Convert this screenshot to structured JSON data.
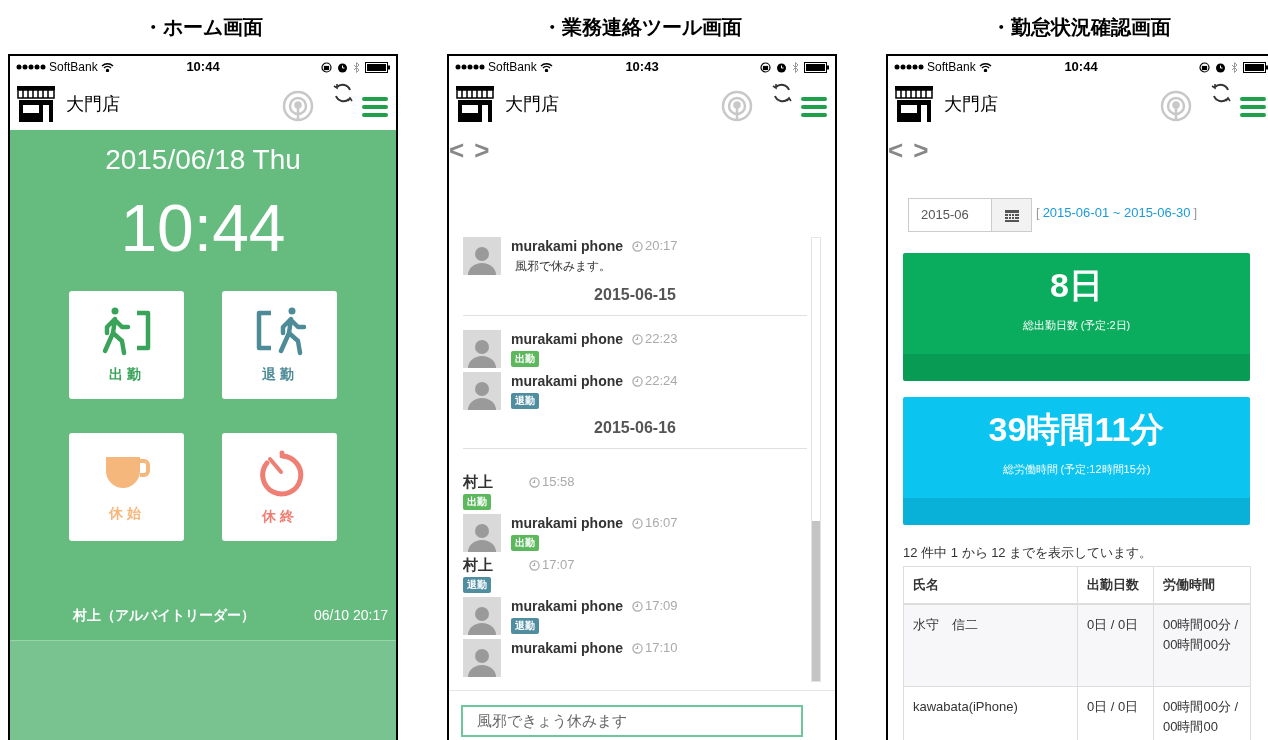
{
  "home": {
    "heading": "・ホーム画面",
    "status_bar": {
      "carrier": "SoftBank",
      "time": "10:44"
    },
    "app_bar": {
      "store": "大門店"
    },
    "date": "2015/06/18 Thu",
    "clock": "10:44",
    "buttons": [
      {
        "label": "出勤",
        "kind": "clock_in"
      },
      {
        "label": "退勤",
        "kind": "clock_out"
      },
      {
        "label": "休始",
        "kind": "break_start"
      },
      {
        "label": "休終",
        "kind": "break_end"
      }
    ],
    "last_punch": {
      "name": "村上（アルバイトリーダー）",
      "time": "06/10 20:17"
    }
  },
  "messages": {
    "heading": "・業務連絡ツール画面",
    "status_bar": {
      "carrier": "SoftBank",
      "time": "10:43"
    },
    "app_bar": {
      "store": "大門店"
    },
    "nav": {
      "prev": "<",
      "next": ">"
    },
    "feed": [
      {
        "kind": "post",
        "avatar": true,
        "name": "murakami phone",
        "time": "20:17",
        "text": "風邪で休みます。"
      },
      {
        "kind": "date",
        "text": "2015-06-15"
      },
      {
        "kind": "post",
        "avatar": true,
        "name": "murakami phone",
        "time": "22:23",
        "badge": {
          "label": "出勤",
          "color": "#5cb85c"
        }
      },
      {
        "kind": "post",
        "avatar": true,
        "name": "murakami phone",
        "time": "22:24",
        "badge": {
          "label": "退勤",
          "color": "#4f8da0"
        }
      },
      {
        "kind": "date",
        "text": "2015-06-16"
      },
      {
        "kind": "post",
        "avatar": false,
        "name": "村上",
        "time": "15:58",
        "badge": {
          "label": "出勤",
          "color": "#5cb85c"
        }
      },
      {
        "kind": "post",
        "avatar": true,
        "name": "murakami phone",
        "time": "16:07",
        "badge": {
          "label": "出勤",
          "color": "#5cb85c"
        }
      },
      {
        "kind": "post",
        "avatar": false,
        "name": "村上",
        "time": "17:07",
        "badge": {
          "label": "退勤",
          "color": "#4f8da0"
        }
      },
      {
        "kind": "post",
        "avatar": true,
        "name": "murakami phone",
        "time": "17:09",
        "badge": {
          "label": "退勤",
          "color": "#4f8da0"
        }
      },
      {
        "kind": "post",
        "avatar": true,
        "name": "murakami phone",
        "time": "17:10"
      }
    ],
    "input": {
      "value": "風邪できょう休みます"
    }
  },
  "attendance": {
    "heading": "・勤怠状況確認画面",
    "status_bar": {
      "carrier": "SoftBank",
      "time": "10:44"
    },
    "app_bar": {
      "store": "大門店"
    },
    "nav": {
      "prev": "<",
      "next": ">"
    },
    "month": "2015-06",
    "range": {
      "open": "[",
      "dates": "2015-06-01 ~ 2015-06-30",
      "close": "]"
    },
    "stats": [
      {
        "value": "8日",
        "label": "総出勤日数 (予定:2日)",
        "color": "#0aad5e"
      },
      {
        "value": "39時間11分",
        "label": "総労働時間 (予定:12時間15分)",
        "color": "#0bc4f0"
      }
    ],
    "summary": "12 件中 1 から 12 までを表示しています。",
    "table": {
      "columns": [
        "氏名",
        "出勤日数",
        "労働時間"
      ],
      "rows": [
        [
          "水守　信二",
          "0日 / 0日",
          "00時間00分 / 00時間00分"
        ],
        [
          "kawabata(iPhone)",
          "0日 / 0日",
          "00時間00分 / 00時間00"
        ]
      ]
    }
  }
}
